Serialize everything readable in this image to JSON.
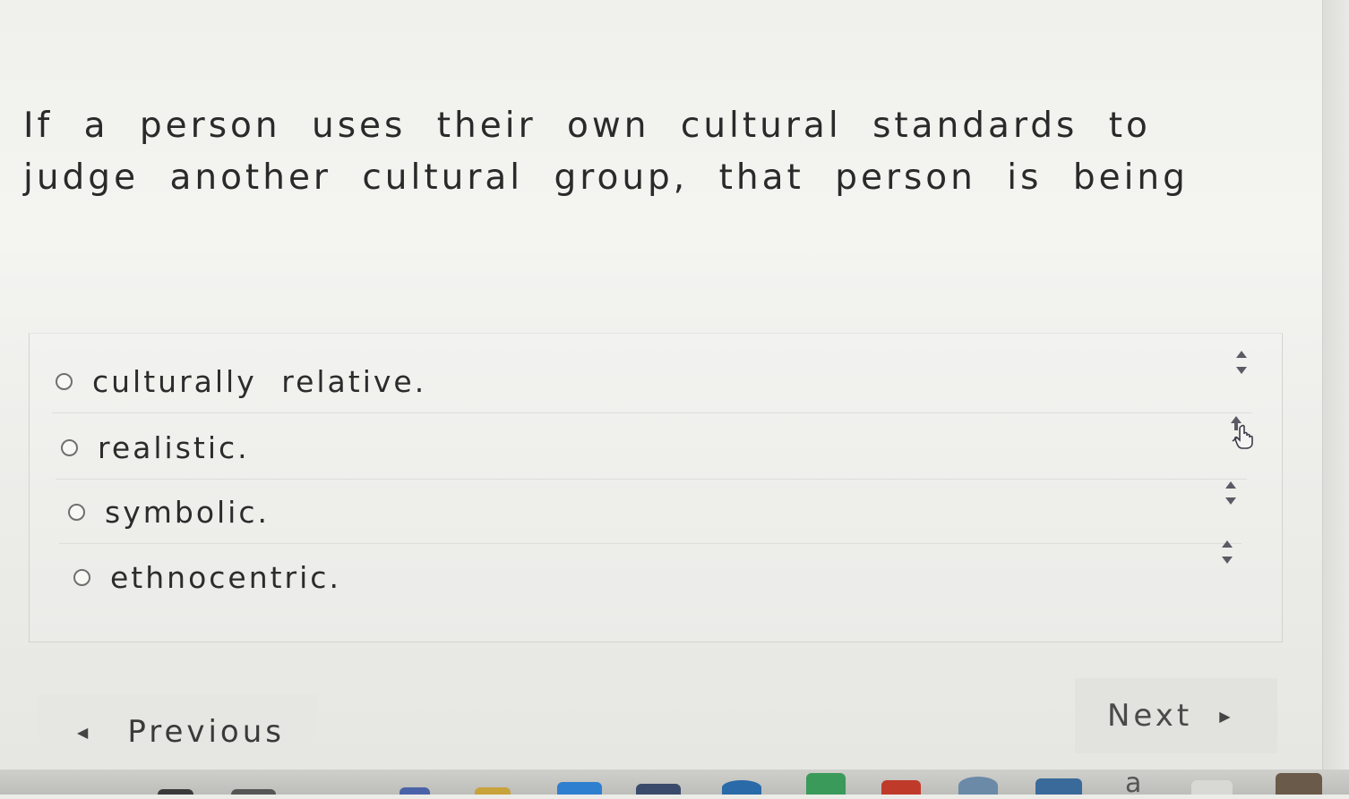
{
  "question": {
    "text": "If a person uses their own cultural standards to judge another cultural group, that person is being"
  },
  "options": [
    {
      "label": "culturally relative."
    },
    {
      "label": "realistic."
    },
    {
      "label": "symbolic."
    },
    {
      "label": "ethnocentric."
    }
  ],
  "navigation": {
    "previous_label": "Previous",
    "next_label": "Next"
  },
  "taskbar": {
    "partial_icon_letter": "a"
  },
  "colors": {
    "text": "#262626",
    "radio_border": "#6f6f6f",
    "sorter_arrow": "#5b5b66",
    "button_bg": "#e6e6e2"
  }
}
